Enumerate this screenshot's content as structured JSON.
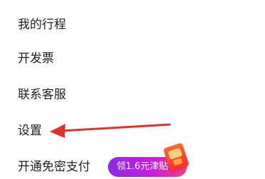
{
  "menu": {
    "items": [
      {
        "label": "我的行程"
      },
      {
        "label": "开发票"
      },
      {
        "label": "联系客服"
      },
      {
        "label": "设置"
      },
      {
        "label": "开通免密支付"
      }
    ],
    "promo": {
      "label": "领1.6元津贴",
      "icon": "coupon-icon"
    }
  },
  "annotation": {
    "arrow_color": "#e0322b",
    "target": "设置"
  },
  "theme": {
    "badge_gradient_start": "#8a2be2",
    "badge_gradient_end": "#ff3a7a"
  }
}
